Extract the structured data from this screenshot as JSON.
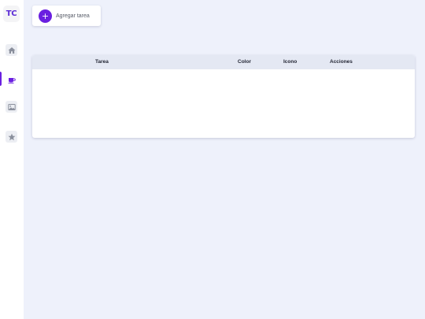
{
  "sidebar": {
    "logo": "TC",
    "items": [
      {
        "name": "home",
        "icon": "home-icon"
      },
      {
        "name": "coffee",
        "icon": "coffee-icon",
        "active": true
      },
      {
        "name": "image",
        "icon": "image-icon"
      },
      {
        "name": "star",
        "icon": "star-icon"
      }
    ]
  },
  "toolbar": {
    "add_icon": "+",
    "add_label": "Agregar tarea"
  },
  "table": {
    "headers": [
      "Tarea",
      "Color",
      "Icono",
      "Acciones"
    ],
    "rows": []
  },
  "colors": {
    "accent": "#6a1fe0",
    "background": "#eef1fb",
    "header_bg": "#e4e8f3",
    "icon_gray": "#8a8f9c"
  }
}
